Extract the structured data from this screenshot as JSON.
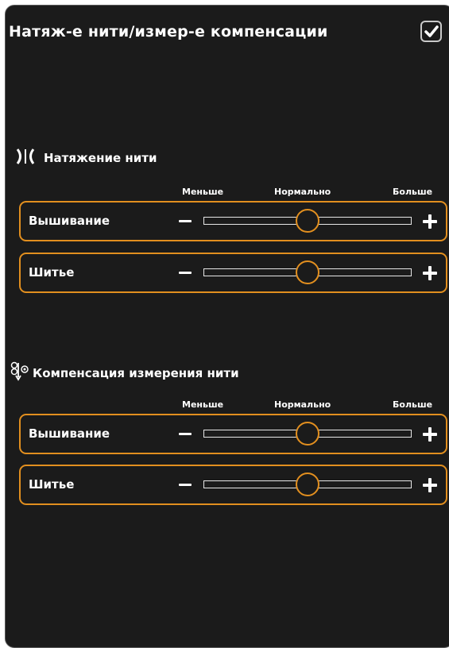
{
  "header": {
    "title": "Натяж-е нити/измер-е компенсации",
    "confirm_icon": "checkmark-icon"
  },
  "tension": {
    "title": "Натяжение нити",
    "icon": "thread-tension-icon",
    "scale": {
      "low": "Меньше",
      "mid": "Нормально",
      "high": "Больше"
    },
    "rows": [
      {
        "label": "Вышивание",
        "value": 0.5
      },
      {
        "label": "Шитье",
        "value": 0.5
      }
    ]
  },
  "portioning": {
    "title": "Компенсация измерения нити",
    "icon": "thread-portioning-icon",
    "scale": {
      "low": "Меньше",
      "mid": "Нормально",
      "high": "Больше"
    },
    "rows": [
      {
        "label": "Вышивание",
        "value": 0.5
      },
      {
        "label": "Шитье",
        "value": 0.5
      }
    ]
  },
  "colors": {
    "accent": "#e28f1f",
    "background": "#1b1b1b",
    "text": "#ffffff"
  }
}
